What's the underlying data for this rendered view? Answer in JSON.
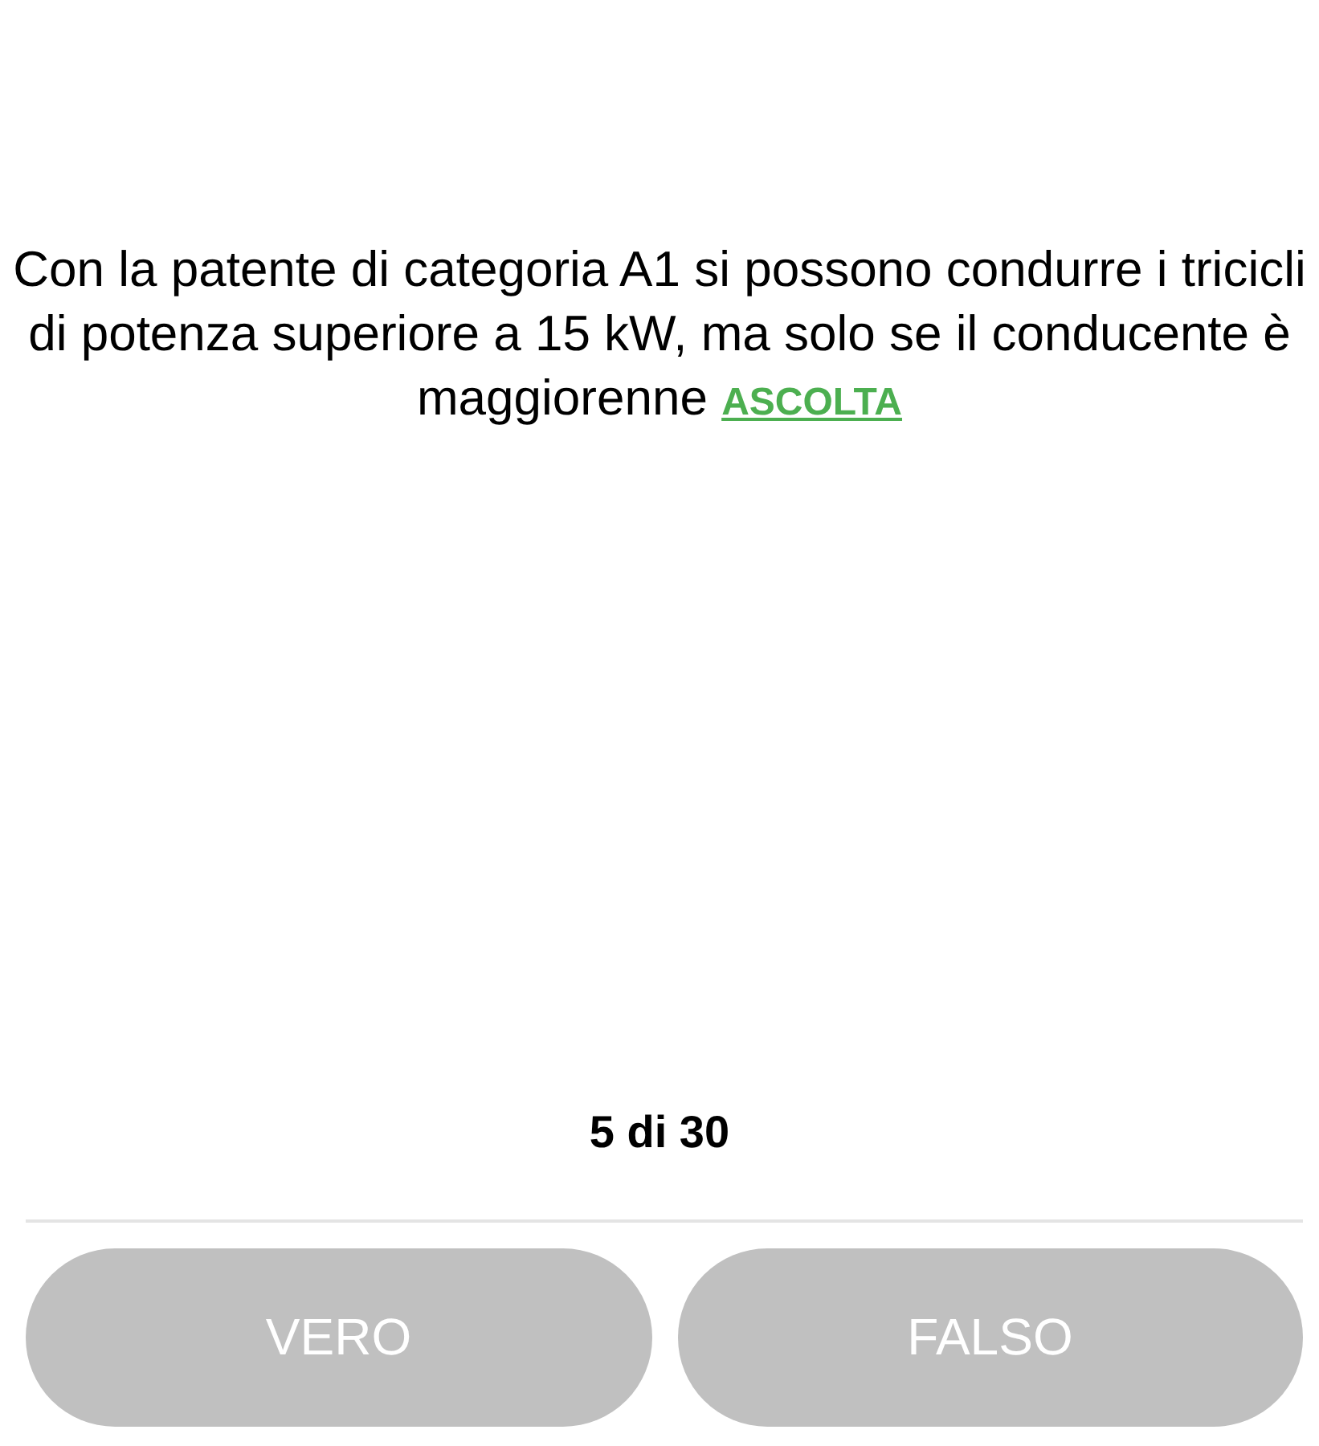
{
  "question": {
    "text": "Con la patente di categoria A1 si possono condurre i tricicli di potenza superiore a 15 kW, ma solo se il conducente è maggiorenne",
    "listen_link": "ASCOLTA"
  },
  "counter": "5 di 30",
  "answers": [
    {
      "label": "VERO",
      "disabled": true
    },
    {
      "label": "FALSO",
      "disabled": true
    }
  ]
}
